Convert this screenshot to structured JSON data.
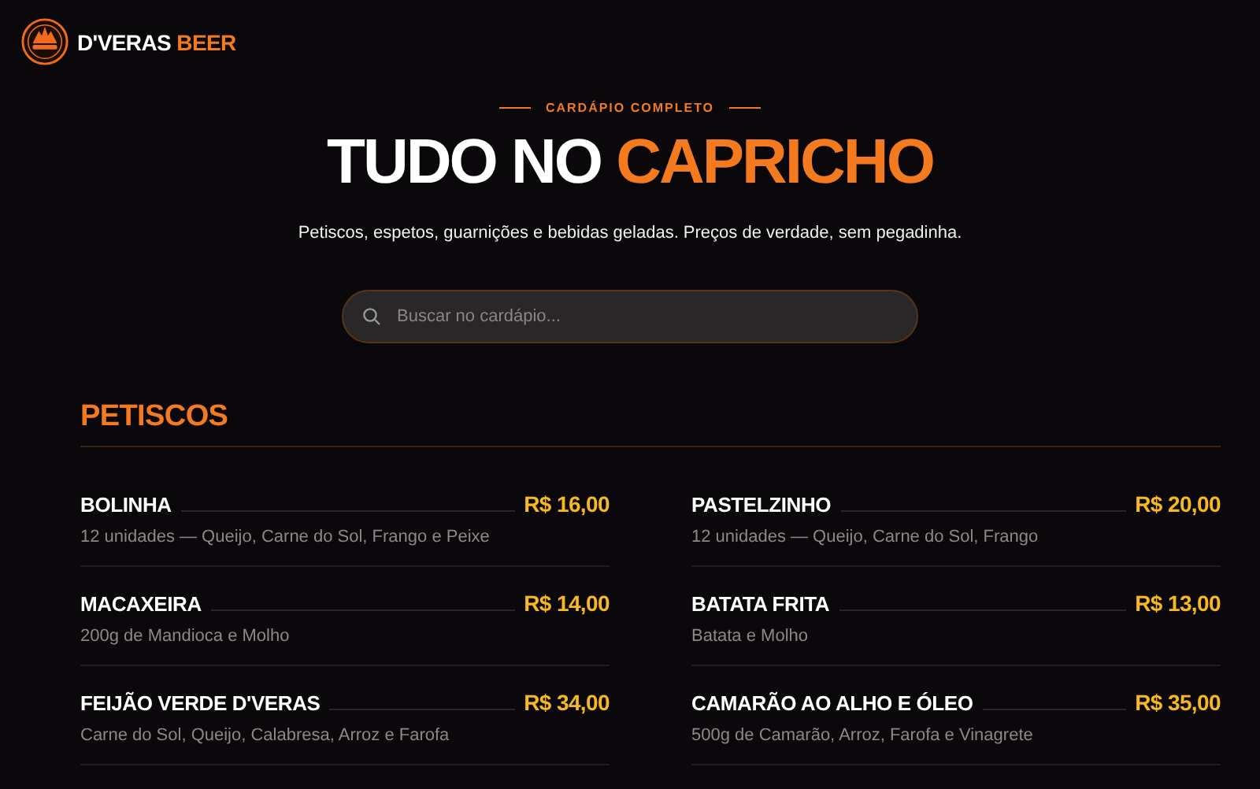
{
  "brand": {
    "name": "D'VERAS",
    "accent": "BEER"
  },
  "hero": {
    "eyebrow": "CARDÁPIO COMPLETO",
    "title": "TUDO NO",
    "title_accent": "CAPRICHO",
    "subtitle": "Petiscos, espetos, guarnições e bebidas geladas. Preços de verdade, sem pegadinha."
  },
  "search": {
    "placeholder": "Buscar no cardápio..."
  },
  "section": {
    "title": "PETISCOS",
    "items": [
      {
        "name": "BOLINHA",
        "price": "R$ 16,00",
        "description": "12 unidades — Queijo, Carne do Sol, Frango e Peixe"
      },
      {
        "name": "PASTELZINHO",
        "price": "R$ 20,00",
        "description": "12 unidades — Queijo, Carne do Sol, Frango"
      },
      {
        "name": "MACAXEIRA",
        "price": "R$ 14,00",
        "description": "200g de Mandioca e Molho"
      },
      {
        "name": "BATATA FRITA",
        "price": "R$ 13,00",
        "description": "Batata e Molho"
      },
      {
        "name": "FEIJÃO VERDE D'VERAS",
        "price": "R$ 34,00",
        "description": "Carne do Sol, Queijo, Calabresa, Arroz e Farofa"
      },
      {
        "name": "CAMARÃO AO ALHO E ÓLEO",
        "price": "R$ 35,00",
        "description": "500g de Camarão, Arroz, Farofa e Vinagrete"
      }
    ]
  }
}
